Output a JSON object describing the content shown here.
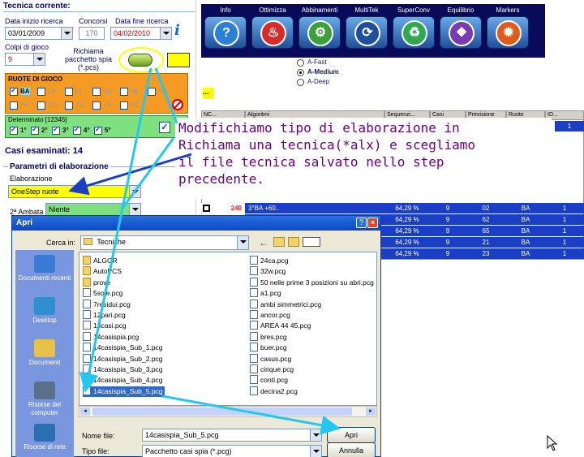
{
  "tecnica": {
    "title": "Tecnica corrente:",
    "data_inizio_label": "Data inizio ricerca",
    "data_inizio": "03/01/2009",
    "concorsi_label": "Concorsi",
    "concorsi": "170",
    "data_fine_label": "Data fine ricerca",
    "data_fine": "04/02/2010",
    "colpi_label": "Colpi di gioco",
    "colpi": "9",
    "richiama_label": "Richiama pacchetto spia (*.pcs)",
    "ruote_title": "RUOTE DI GIOCO",
    "ruote": [
      {
        "label": "BA",
        "checked": true
      },
      {
        "label": "CA",
        "checked": false
      },
      {
        "label": "FI",
        "checked": false
      },
      {
        "label": "GE",
        "checked": false
      },
      {
        "label": "MI",
        "checked": false
      },
      {
        "label": "NA",
        "checked": false
      },
      {
        "label": "PA",
        "checked": false
      },
      {
        "label": "RO",
        "checked": false
      },
      {
        "label": "TO",
        "checked": false
      },
      {
        "label": "VE",
        "checked": false
      },
      {
        "label": "NZ",
        "checked": false
      }
    ],
    "determinato_title": "Determinato [12345]",
    "determinato": [
      "1°",
      "2°",
      "3°",
      "4°",
      "5°"
    ],
    "casi_esaminati": "Casi esaminati: 14",
    "parametri_title": "Parametri di elaborazione",
    "elaborazione_label": "Elaborazione",
    "elaborazione": "OneStep ruote",
    "ambata_label": "2ª Ambata",
    "ambata": "Niente"
  },
  "toolbar": {
    "buttons": [
      {
        "label": "Info",
        "glyph": "?",
        "icon": "question-icon",
        "color": "#2b7fd6"
      },
      {
        "label": "Ottimizza",
        "glyph": "♨",
        "icon": "flame-icon",
        "color": "#d62b2b"
      },
      {
        "label": "Abbinamenti",
        "glyph": "⚙",
        "icon": "gear-icon",
        "color": "#3aa03a"
      },
      {
        "label": "MultiTek",
        "glyph": "⟳",
        "icon": "swirl-icon",
        "color": "#1f4f9a"
      },
      {
        "label": "SuperConv",
        "glyph": "♻",
        "icon": "recycle-icon",
        "color": "#2fa84f"
      },
      {
        "label": "Equilibrio",
        "glyph": "❖",
        "icon": "puzzle-icon",
        "color": "#7a3ab0"
      },
      {
        "label": "Markers",
        "glyph": "✹",
        "icon": "burst-icon",
        "color": "#e05a1a"
      }
    ],
    "modes": [
      {
        "label": "A-Fast",
        "selected": false
      },
      {
        "label": "A-Medium",
        "selected": true
      },
      {
        "label": "A-Deep",
        "selected": false
      }
    ]
  },
  "grid": {
    "headers": [
      "NC...",
      "Algoritmi",
      "Sequenzi...",
      "Casi",
      "Previsione",
      "Ruote",
      "ID..."
    ],
    "first_row": {
      "caso": "",
      "algoritmo": "",
      "perc": "",
      "casi": "",
      "previsione": "",
      "ruote": "",
      "id": "1"
    },
    "rows": [
      {
        "nc": "240",
        "algoritmo": "3°BA +60..",
        "perc": "64,29 %",
        "casi": "9",
        "previsione": "02",
        "ruota": "BA",
        "id": "1"
      },
      {
        "nc": "",
        "algoritmo": "",
        "perc": "64,29 %",
        "casi": "9",
        "previsione": "62",
        "ruota": "BA",
        "id": "1"
      },
      {
        "nc": "",
        "algoritmo": "",
        "perc": "64,29 %",
        "casi": "9",
        "previsione": "65",
        "ruota": "BA",
        "id": "1"
      },
      {
        "nc": "",
        "algoritmo": "",
        "perc": "64,29 %",
        "casi": "9",
        "previsione": "21",
        "ruota": "BA",
        "id": "1"
      },
      {
        "nc": "",
        "algoritmo": "",
        "perc": "64,29 %",
        "casi": "9",
        "previsione": "23",
        "ruota": "BA",
        "id": "1"
      }
    ]
  },
  "note": {
    "lines": [
      "Modifichiamo tipo di elaborazione in",
      "Richiama una tecnica(*alx) e scegliamo",
      "il file tecnica salvato nello step",
      "precedente."
    ]
  },
  "dialog": {
    "title": "Apri",
    "cerca_label": "Cerca in:",
    "cerca_value": "Tecniche",
    "places": [
      "Documenti recenti",
      "Desktop",
      "Documenti",
      "Risorse del computer",
      "Risorse di rete"
    ],
    "files_col1": [
      {
        "name": "ALGOR",
        "type": "folder"
      },
      {
        "name": "AutoPCS",
        "type": "folder"
      },
      {
        "name": "prove",
        "type": "folder"
      },
      {
        "name": "5sole.pcg",
        "type": "doc"
      },
      {
        "name": "7residui.pcg",
        "type": "doc"
      },
      {
        "name": "12pari.pcg",
        "type": "doc"
      },
      {
        "name": "13casi.pcg",
        "type": "doc"
      },
      {
        "name": "14casispia.pcg",
        "type": "doc"
      },
      {
        "name": "14casispia_Sub_1.pcg",
        "type": "doc"
      },
      {
        "name": "14casispia_Sub_2.pcg",
        "type": "doc"
      },
      {
        "name": "14casispia_Sub_3.pcg",
        "type": "doc"
      },
      {
        "name": "14casispia_Sub_4.pcg",
        "type": "doc"
      },
      {
        "name": "14casispia_Sub_5.pcg",
        "type": "doc"
      }
    ],
    "files_col2": [
      {
        "name": "24ca.pcg",
        "type": "doc"
      },
      {
        "name": "32w.pcg",
        "type": "doc"
      },
      {
        "name": "50 nelle prime 3 posizioni su abri.pcg",
        "type": "doc"
      },
      {
        "name": "a1.pcg",
        "type": "doc"
      },
      {
        "name": "ambi simmetrici.pcg",
        "type": "doc"
      },
      {
        "name": "ancor.pcg",
        "type": "doc"
      },
      {
        "name": "AREA 44 45.pcg",
        "type": "doc"
      },
      {
        "name": "bres.pcg",
        "type": "doc"
      },
      {
        "name": "buer.pcg",
        "type": "doc"
      },
      {
        "name": "casus.pcg",
        "type": "doc"
      },
      {
        "name": "cinque.pcg",
        "type": "doc"
      },
      {
        "name": "conti.pcg",
        "type": "doc"
      },
      {
        "name": "decina2.pcg",
        "type": "doc"
      }
    ],
    "selected_file": "14casispia_Sub_5.pcg",
    "nome_label": "Nome file:",
    "nome_value": "14casispia_Sub_5.pcg",
    "tipo_label": "Tipo file:",
    "tipo_value": "Pacchetto casi spia (*.pcg)",
    "open_label": "Apri",
    "cancel_label": "Annulla",
    "help_glyph": "?",
    "close_glyph": "×"
  },
  "colors": {
    "orange_panel": "#f59a23",
    "green_panel": "#7fe07f",
    "yellow_field": "#ffff00",
    "toolbar_bg": "#0a0a5a",
    "grid_bg": "#1a3fc4",
    "arrow": "#23c8f0",
    "note_text": "#6b0080"
  }
}
